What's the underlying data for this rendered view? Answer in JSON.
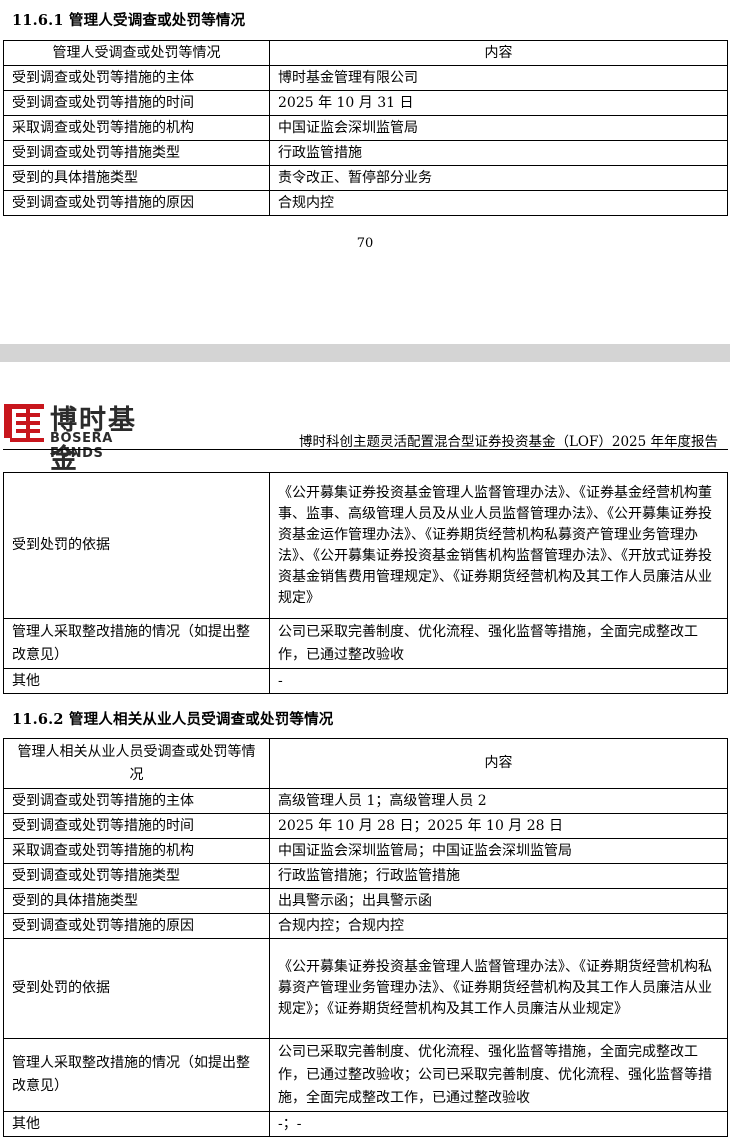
{
  "section1": {
    "heading": "11.6.1  管理人受调查或处罚等情况",
    "col_header": "管理人受调查或处罚等情况",
    "col_content": "内容",
    "rows": [
      {
        "label": "受到调查或处罚等措施的主体",
        "value": "博时基金管理有限公司"
      },
      {
        "label": "受到调查或处罚等措施的时间",
        "value": "2025 年 10 月 31 日"
      },
      {
        "label": "采取调查或处罚等措施的机构",
        "value": "中国证监会深圳监管局"
      },
      {
        "label": "受到调查或处罚等措施类型",
        "value": "行政监管措施"
      },
      {
        "label": "受到的具体措施类型",
        "value": "责令改正、暂停部分业务"
      },
      {
        "label": "受到调查或处罚等措施的原因",
        "value": "合规内控"
      }
    ],
    "cont_rows": [
      {
        "label": "受到处罚的依据",
        "value": "《公开募集证券投资基金管理人监督管理办法》、《证券基金经营机构董事、监事、高级管理人员及从业人员监督管理办法》、《公开募集证券投资基金运作管理办法》、《证券期货经营机构私募资产管理业务管理办法》、《公开募集证券投资基金销售机构监督管理办法》、《开放式证券投资基金销售费用管理规定》、《证券期货经营机构及其工作人员廉洁从业规定》"
      },
      {
        "label": "管理人采取整改措施的情况（如提出整改意见）",
        "value": "公司已采取完善制度、优化流程、强化监督等措施，全面完成整改工作，已通过整改验收"
      },
      {
        "label": "其他",
        "value": "-"
      }
    ]
  },
  "page_number": "70",
  "header": {
    "logo_cn": "博时基金",
    "logo_en": "BOSERA FUNDS",
    "report_title": "博时科创主题灵活配置混合型证券投资基金（LOF）2025 年年度报告"
  },
  "section2": {
    "heading": "11.6.2  管理人相关从业人员受调查或处罚等情况",
    "col_header": "管理人相关从业人员受调查或处罚等情况",
    "col_content": "内容",
    "rows": [
      {
        "label": "受到调查或处罚等措施的主体",
        "value": "高级管理人员 1；高级管理人员 2"
      },
      {
        "label": "受到调查或处罚等措施的时间",
        "value": "2025 年 10 月 28 日；2025 年 10 月 28 日"
      },
      {
        "label": "采取调查或处罚等措施的机构",
        "value": "中国证监会深圳监管局；中国证监会深圳监管局"
      },
      {
        "label": "受到调查或处罚等措施类型",
        "value": "行政监管措施；行政监管措施"
      },
      {
        "label": "受到的具体措施类型",
        "value": "出具警示函；出具警示函"
      },
      {
        "label": "受到调查或处罚等措施的原因",
        "value": "合规内控；合规内控"
      },
      {
        "label": "受到处罚的依据",
        "value": "《公开募集证券投资基金管理人监督管理办法》、《证券期货经营机构私募资产管理业务管理办法》、《证券期货经营机构及其工作人员廉洁从业规定》；《证券期货经营机构及其工作人员廉洁从业规定》"
      },
      {
        "label": "管理人采取整改措施的情况（如提出整改意见）",
        "value": "公司已采取完善制度、优化流程、强化监督等措施，全面完成整改工作，已通过整改验收；公司已采取完善制度、优化流程、强化监督等措施，全面完成整改工作，已通过整改验收"
      },
      {
        "label": "其他",
        "value": "-；-"
      }
    ]
  }
}
